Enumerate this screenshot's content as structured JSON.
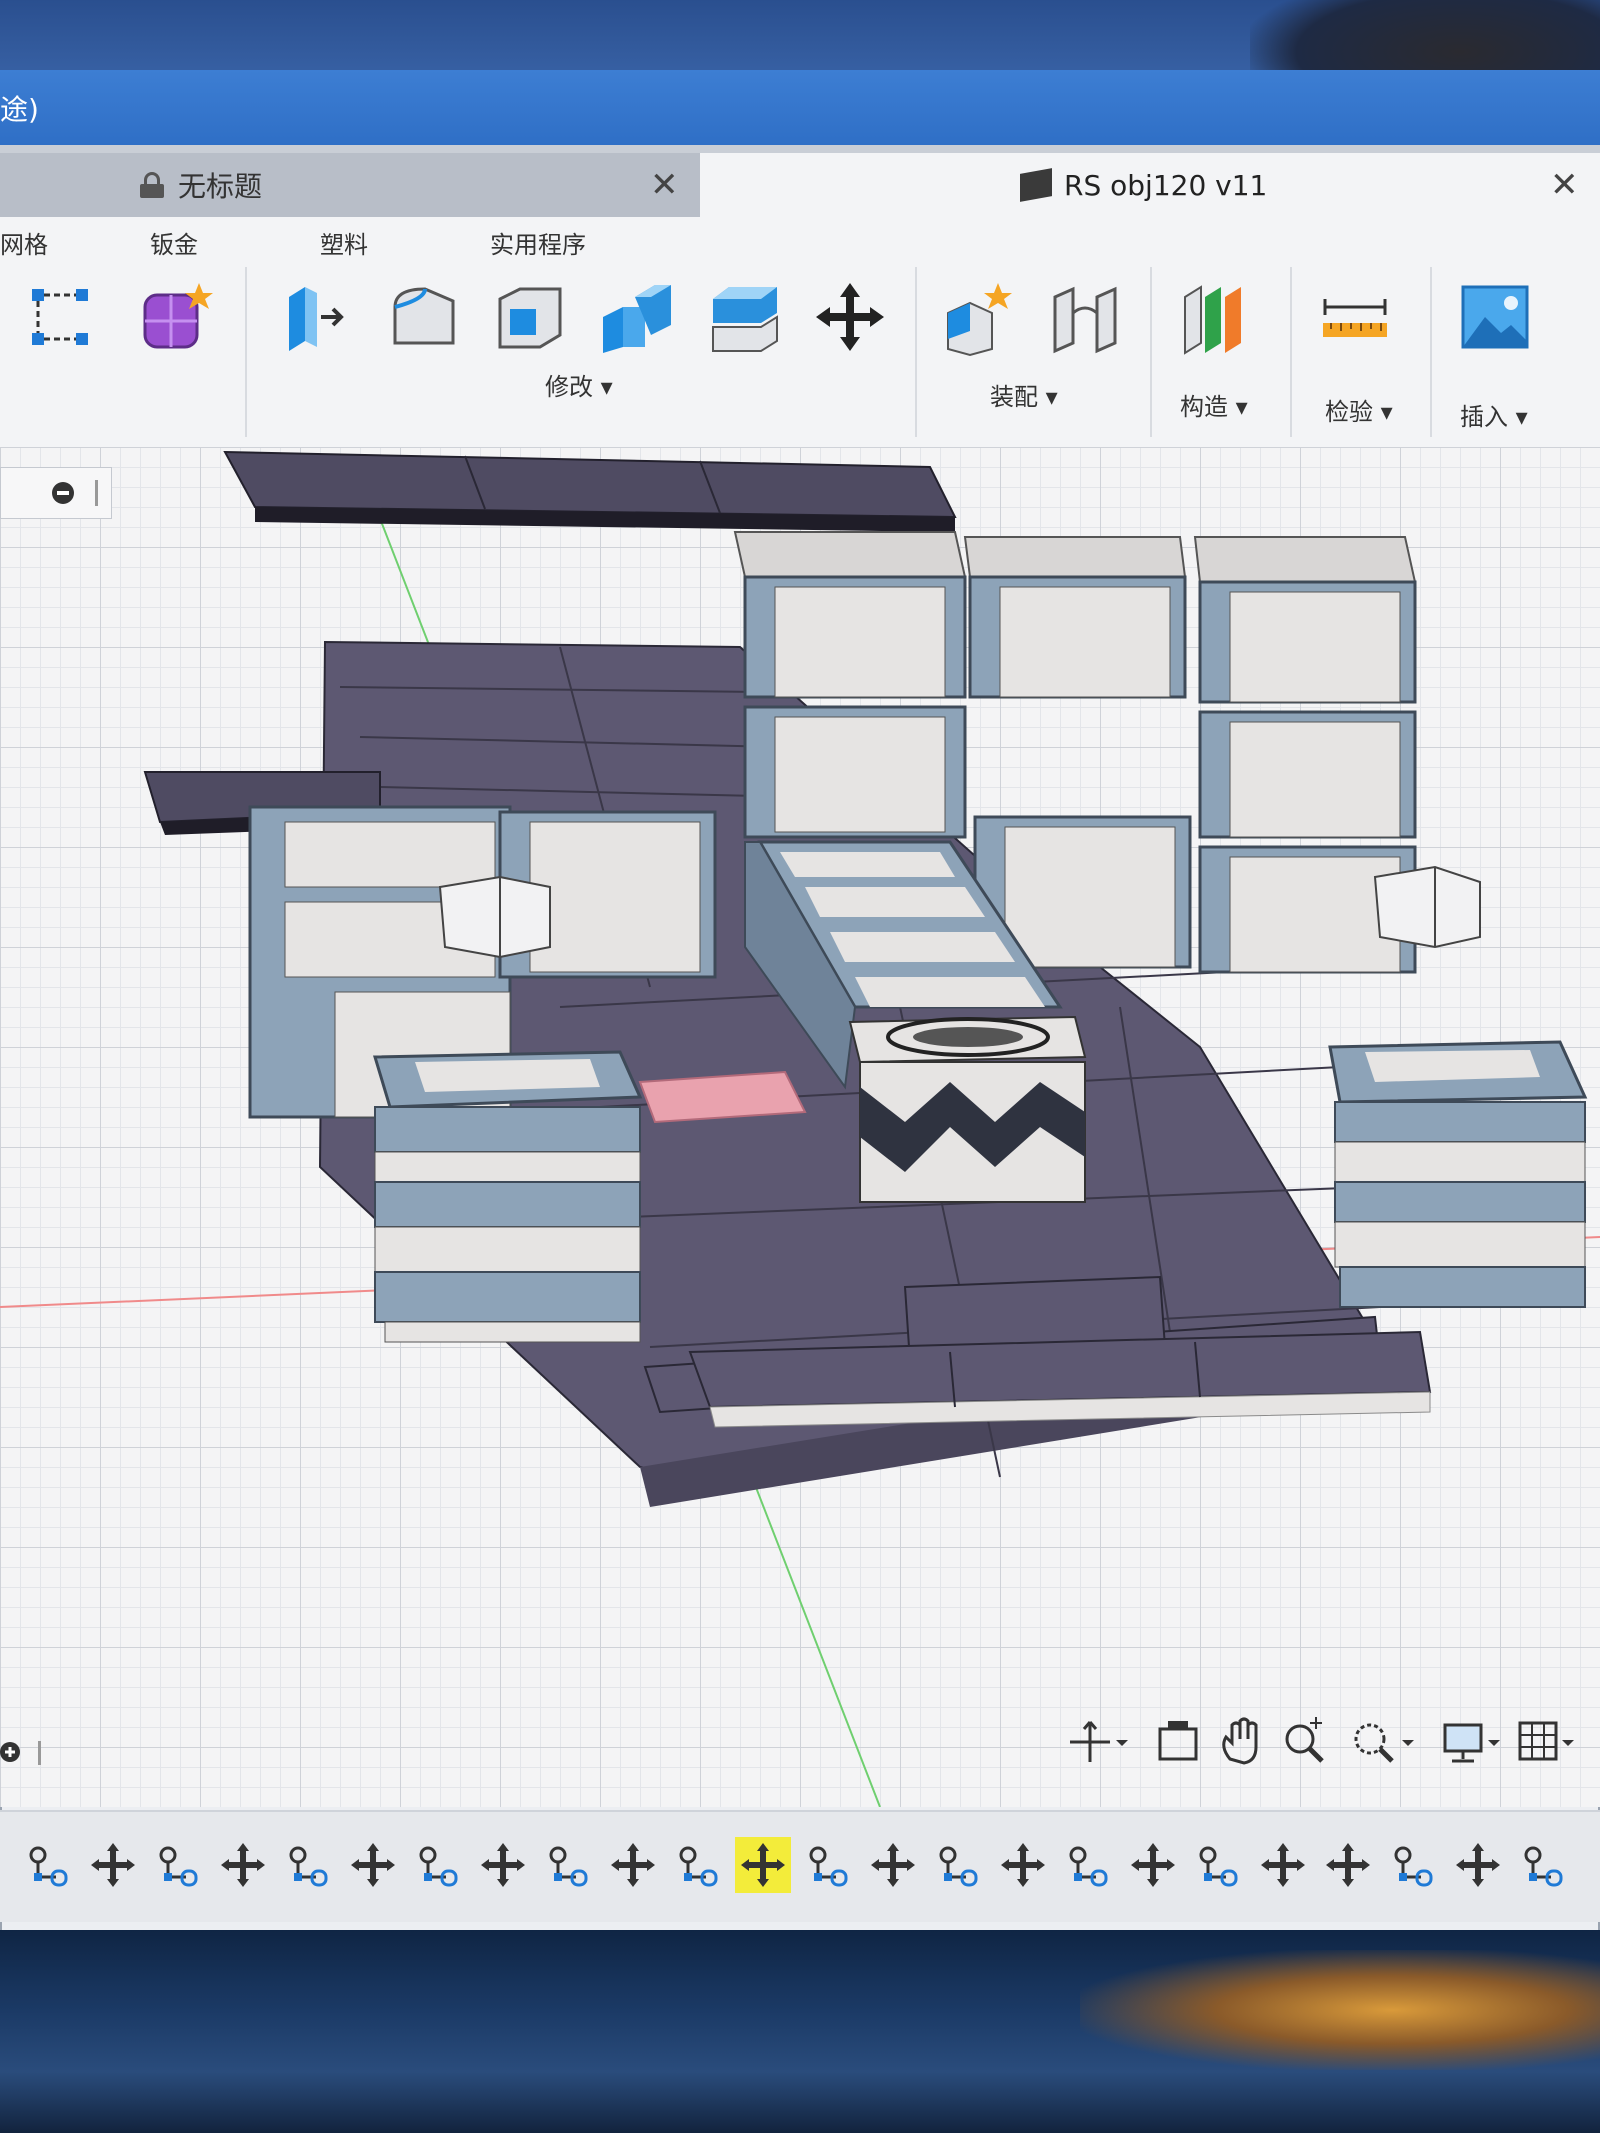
{
  "window_fragment": "途)",
  "tabs": {
    "untitled": {
      "label": "无标题"
    },
    "active": {
      "label": "RS obj120 v11"
    }
  },
  "menus": [
    "网格",
    "钣金",
    "塑料",
    "实用程序"
  ],
  "groups": {
    "modify": "修改 ▾",
    "assemble": "装配 ▾",
    "construct": "构造 ▾",
    "inspect": "检验 ▾",
    "insert": "插入 ▾"
  },
  "colors": {
    "dark_tile": "#4f4b62",
    "light_panel": "#e6e4e3",
    "frame": "#8da3b8",
    "accent_tile": "#e9a2ae",
    "timeline_active": "#f3ec3a"
  },
  "timeline": {
    "items": [
      "sketch",
      "move",
      "sketch",
      "move",
      "sketch",
      "move",
      "sketch",
      "move",
      "sketch",
      "move",
      "sketch",
      "move",
      "sketch",
      "move",
      "sketch",
      "move",
      "sketch",
      "move",
      "sketch",
      "move",
      "move",
      "sketch",
      "move",
      "sketch"
    ],
    "active_index": 11
  }
}
